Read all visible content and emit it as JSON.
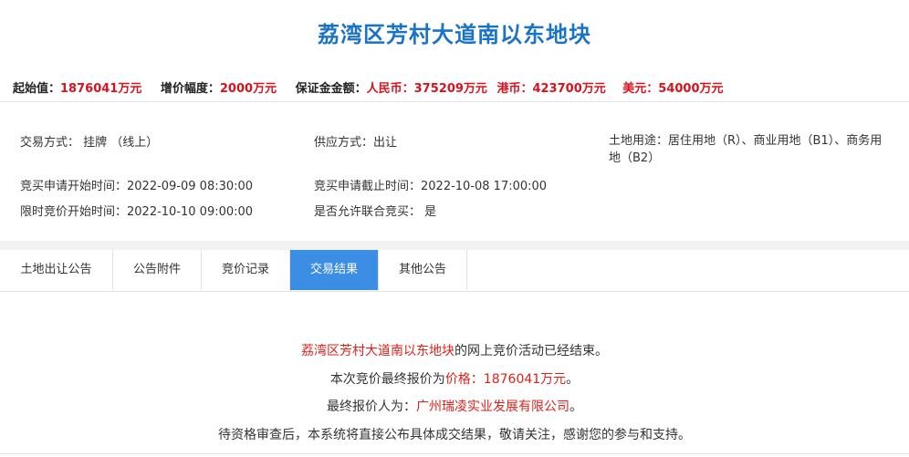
{
  "title": "荔湾区芳村大道南以东地块",
  "price_bar": {
    "start_label": "起始值：",
    "start_value": "1876041万元",
    "increment_label": "增价幅度：",
    "increment_value": "2000万元",
    "deposit_label": "保证金金额：",
    "rmb_label": "人民币：",
    "rmb_value": "375209万元",
    "hkd_label": "港币：",
    "hkd_value": "423700万元",
    "usd_label": "美元：",
    "usd_value": "54000万元"
  },
  "info": {
    "trade_method": "交易方式： 挂牌 （线上）",
    "supply_method": "供应方式：出让",
    "land_use": "土地用途：居住用地（R）、商业用地（B1）、商务用地（B2）",
    "apply_start": "竞买申请开始时间：2022-09-09 08:30:00",
    "apply_end": "竞买申请截止时间：2022-10-08 17:00:00",
    "bid_start": "限时竞价开始时间：2022-10-10 09:00:00",
    "joint_bid": "是否允许联合竞买： 是"
  },
  "tabs": [
    {
      "label": "土地出让公告",
      "active": false
    },
    {
      "label": "公告附件",
      "active": false
    },
    {
      "label": "竞价记录",
      "active": false
    },
    {
      "label": "交易结果",
      "active": true
    },
    {
      "label": "其他公告",
      "active": false
    }
  ],
  "result": {
    "line1_parcel": "荔湾区芳村大道南以东地块",
    "line1_rest": "的网上竞价活动已经结束。",
    "line2_prefix": "本次竞价最终报价为",
    "line2_price": "价格：1876041万元",
    "line2_suffix": "。",
    "line3_prefix": "最终报价人为：",
    "line3_bidder": "广州瑞凌实业发展有限公司",
    "line3_suffix": "。",
    "line4": "待资格审查后，本系统将直接公布具体成交结果，敬请关注，感谢您的参与和支持。"
  },
  "colors": {
    "title": "#1a73c8",
    "highlight_red": "#e0211a",
    "tab_active": "#3b8ee4"
  }
}
